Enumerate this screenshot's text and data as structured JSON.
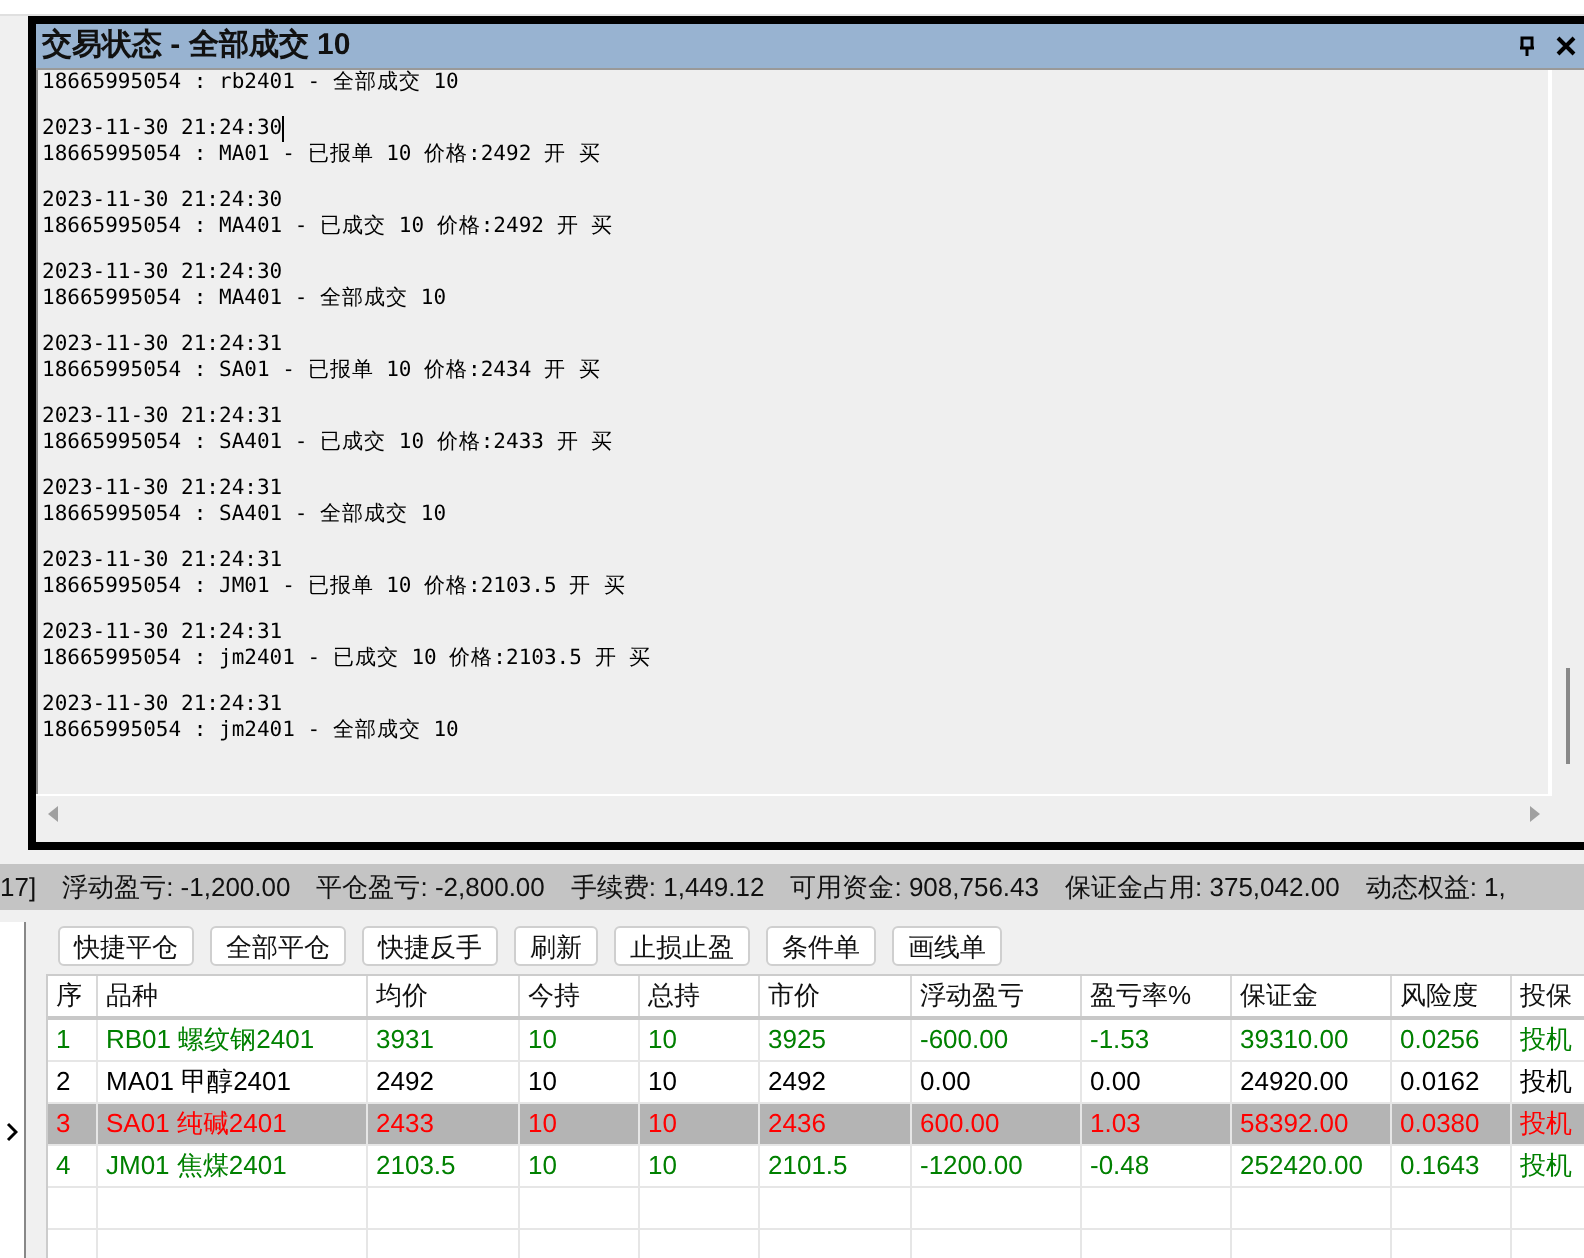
{
  "window": {
    "title": "交易状态 - 全部成交 10"
  },
  "log": [
    {
      "message": "18665995054 : rb2401 - 全部成交 10",
      "cursor": false
    },
    {
      "time": "2023-11-30 21:24:30",
      "message": "18665995054 : MA01 - 已报单 10 价格:2492 开 买",
      "cursor": true
    },
    {
      "time": "2023-11-30 21:24:30",
      "message": "18665995054 : MA401 - 已成交 10 价格:2492 开 买",
      "cursor": false
    },
    {
      "time": "2023-11-30 21:24:30",
      "message": "18665995054 : MA401 - 全部成交 10",
      "cursor": false
    },
    {
      "time": "2023-11-30 21:24:31",
      "message": "18665995054 : SA01 - 已报单 10 价格:2434 开 买",
      "cursor": false
    },
    {
      "time": "2023-11-30 21:24:31",
      "message": "18665995054 : SA401 - 已成交 10 价格:2433 开 买",
      "cursor": false
    },
    {
      "time": "2023-11-30 21:24:31",
      "message": "18665995054 : SA401 - 全部成交 10",
      "cursor": false
    },
    {
      "time": "2023-11-30 21:24:31",
      "message": "18665995054 : JM01 - 已报单 10 价格:2103.5 开 买",
      "cursor": false
    },
    {
      "time": "2023-11-30 21:24:31",
      "message": "18665995054 : jm2401 - 已成交 10 价格:2103.5 开 买",
      "cursor": false
    },
    {
      "time": "2023-11-30 21:24:31",
      "message": "18665995054 : jm2401 - 全部成交 10",
      "cursor": false
    }
  ],
  "status_bar": [
    "17]",
    "浮动盈亏: -1,200.00",
    "平仓盈亏: -2,800.00",
    "手续费: 1,449.12",
    "可用资金: 908,756.43",
    "保证金占用: 375,042.00",
    "动态权益: 1,"
  ],
  "toolbar": [
    "快捷平仓",
    "全部平仓",
    "快捷反手",
    "刷新",
    "止损止盈",
    "条件单",
    "画线单"
  ],
  "table": {
    "columns": [
      "序",
      "品种",
      "均价",
      "今持",
      "总持",
      "市价",
      "浮动盈亏",
      "盈亏率%",
      "保证金",
      "风险度",
      "投保"
    ],
    "rows": [
      {
        "cells": [
          "1",
          "RB01 螺纹钢2401",
          "3931",
          "10",
          "10",
          "3925",
          "-600.00",
          "-1.53",
          "39310.00",
          "0.0256",
          "投机"
        ],
        "color": "#008000",
        "selected": false
      },
      {
        "cells": [
          "2",
          "MA01 甲醇2401",
          "2492",
          "10",
          "10",
          "2492",
          "0.00",
          "0.00",
          "24920.00",
          "0.0162",
          "投机"
        ],
        "color": "#000000",
        "selected": false
      },
      {
        "cells": [
          "3",
          "SA01 纯碱2401",
          "2433",
          "10",
          "10",
          "2436",
          "600.00",
          "1.03",
          "58392.00",
          "0.0380",
          "投机"
        ],
        "color": "#ff0000",
        "selected": true
      },
      {
        "cells": [
          "4",
          "JM01 焦煤2401",
          "2103.5",
          "10",
          "10",
          "2101.5",
          "-1200.00",
          "-0.48",
          "252420.00",
          "0.1643",
          "投机"
        ],
        "color": "#008000",
        "selected": false
      }
    ]
  }
}
